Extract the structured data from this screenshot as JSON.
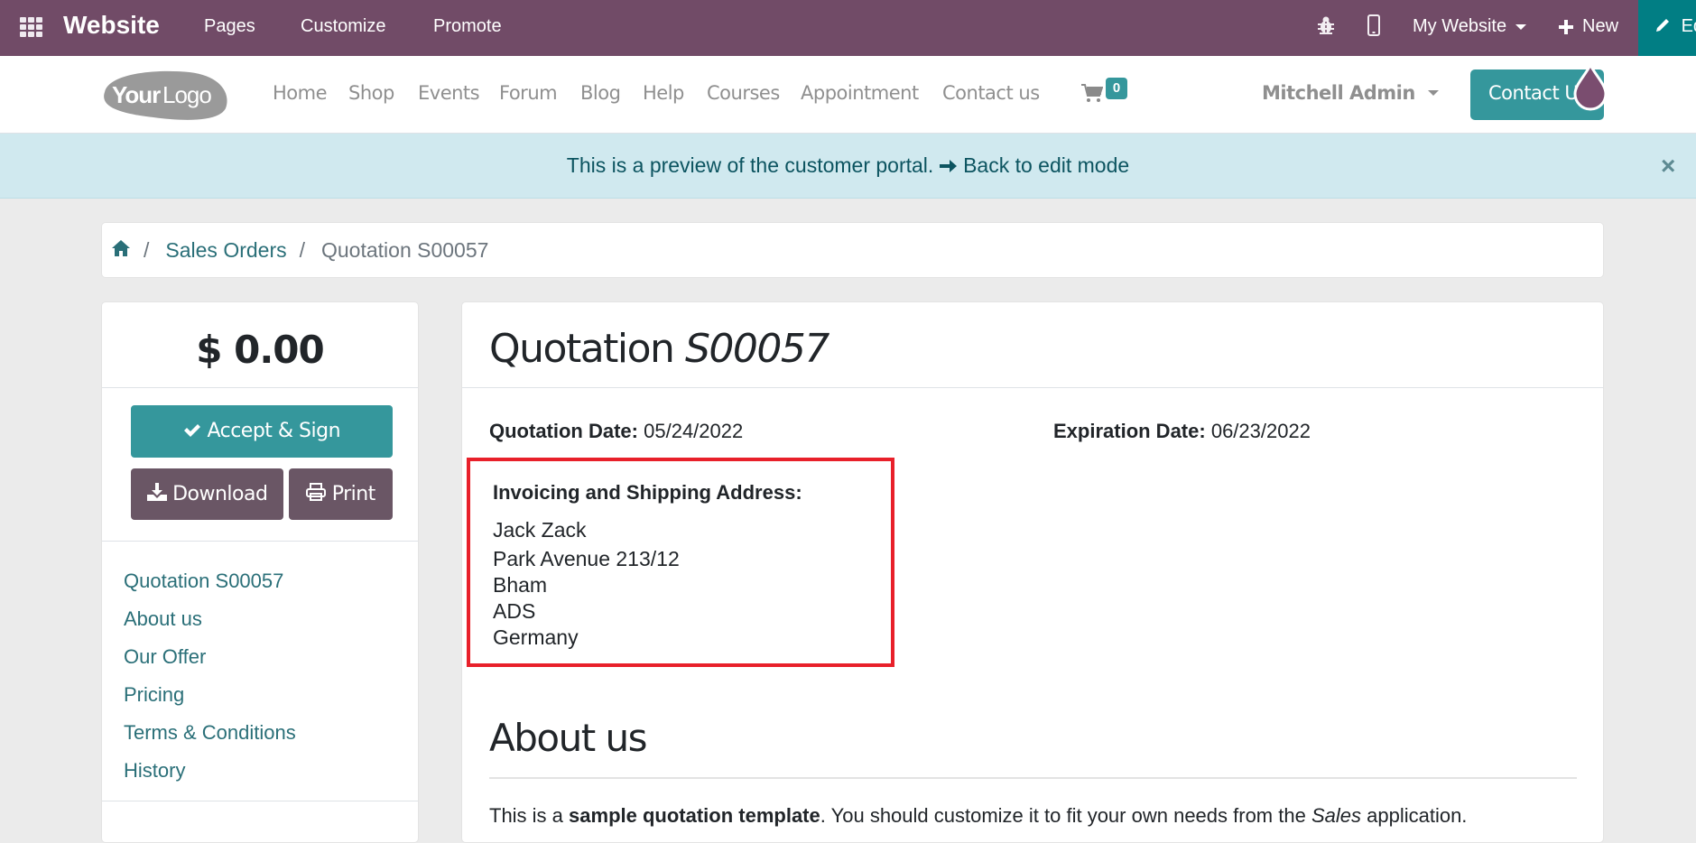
{
  "topbar": {
    "brand": "Website",
    "menus": [
      "Pages",
      "Customize",
      "Promote"
    ],
    "my_website": "My Website",
    "new_label": "New",
    "edit_label": "Edit"
  },
  "header": {
    "logo_text_bold": "Your",
    "logo_text_light": "Logo",
    "nav": [
      "Home",
      "Shop",
      "Events",
      "Forum",
      "Blog",
      "Help",
      "Courses",
      "Appointment",
      "Contact us"
    ],
    "cart_count": "0",
    "user": "Mitchell Admin",
    "contact_button": "Contact Us"
  },
  "alert": {
    "text": "This is a preview of the customer portal.",
    "link": "Back to edit mode",
    "close": "×"
  },
  "breadcrumb": {
    "items": [
      "Sales Orders",
      "Quotation S00057"
    ]
  },
  "sidebar": {
    "amount": "$ 0.00",
    "accept_label": "Accept & Sign",
    "download_label": "Download",
    "print_label": "Print",
    "toc": [
      "Quotation S00057",
      "About us",
      "Our Offer",
      "Pricing",
      "Terms & Conditions",
      "History"
    ]
  },
  "main": {
    "title_prefix": "Quotation",
    "title_ref": "S00057",
    "quotation_date_label": "Quotation Date:",
    "quotation_date": "05/24/2022",
    "expiration_date_label": "Expiration Date:",
    "expiration_date": "06/23/2022",
    "address_title": "Invoicing and Shipping Address:",
    "address_lines": [
      "Jack Zack",
      "Park Avenue 213/12",
      "Bham",
      "ADS",
      "Germany"
    ],
    "about_heading": "About us",
    "about_text_1": "This is a ",
    "about_text_bold": "sample quotation template",
    "about_text_2": ". You should customize it to fit your own needs from the ",
    "about_text_italic": "Sales",
    "about_text_3": " application."
  },
  "colors": {
    "topbar": "#714b67",
    "accent": "#35979c",
    "edit": "#017e84",
    "secondary_button": "#6a5665",
    "highlight_border": "#e8202a"
  }
}
